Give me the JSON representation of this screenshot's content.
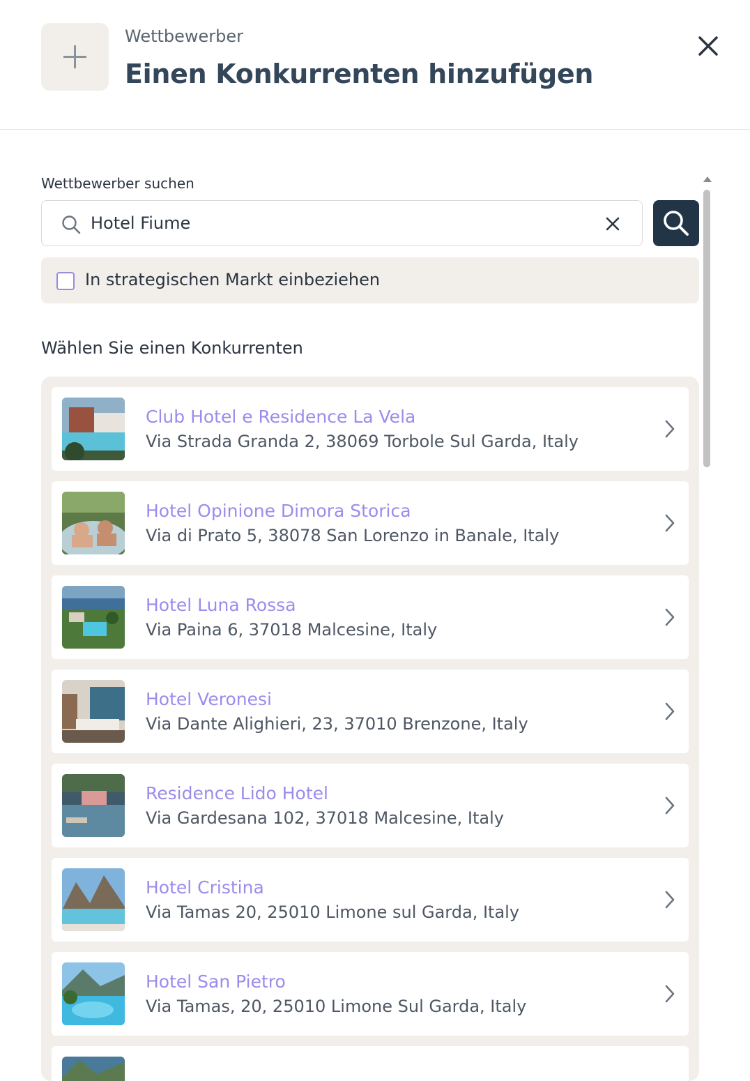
{
  "header": {
    "subtitle": "Wettbewerber",
    "title": "Einen Konkurrenten hinzufügen"
  },
  "search": {
    "label": "Wettbewerber suchen",
    "value": "Hotel Fiume",
    "placeholder": ""
  },
  "strategic_market": {
    "label": "In strategischen Markt einbeziehen",
    "checked": false
  },
  "results": {
    "heading": "Wählen Sie einen Konkurrenten",
    "items": [
      {
        "name": "Club Hotel e Residence La Vela",
        "address": "Via Strada Granda 2, 38069 Torbole Sul Garda, Italy",
        "image": "hotel-pool-building"
      },
      {
        "name": "Hotel Opinione Dimora Storica",
        "address": "Via di Prato 5, 38078 San Lorenzo in Banale, Italy",
        "image": "hot-tub-couple"
      },
      {
        "name": "Hotel Luna Rossa",
        "address": "Via Paina 6, 37018 Malcesine, Italy",
        "image": "lake-aerial-pool"
      },
      {
        "name": "Hotel Veronesi",
        "address": "Via Dante Alighieri, 23, 37010 Brenzone, Italy",
        "image": "hotel-room"
      },
      {
        "name": "Residence Lido Hotel",
        "address": "Via Gardesana 102, 37018 Malcesine, Italy",
        "image": "lakeside-hotel"
      },
      {
        "name": "Hotel Cristina",
        "address": "Via Tamas 20, 25010 Limone sul Garda, Italy",
        "image": "mountain-pool"
      },
      {
        "name": "Hotel San Pietro",
        "address": "Via Tamas, 20, 25010 Limone Sul Garda, Italy",
        "image": "resort-pool"
      }
    ]
  },
  "colors": {
    "accent_link": "#9b8cec",
    "primary_button": "#223547",
    "panel_bg": "#f2efea"
  },
  "icons": [
    "plus-icon",
    "close-icon",
    "search-icon",
    "clear-icon",
    "chevron-right-icon",
    "scroll-up-arrow-icon"
  ]
}
